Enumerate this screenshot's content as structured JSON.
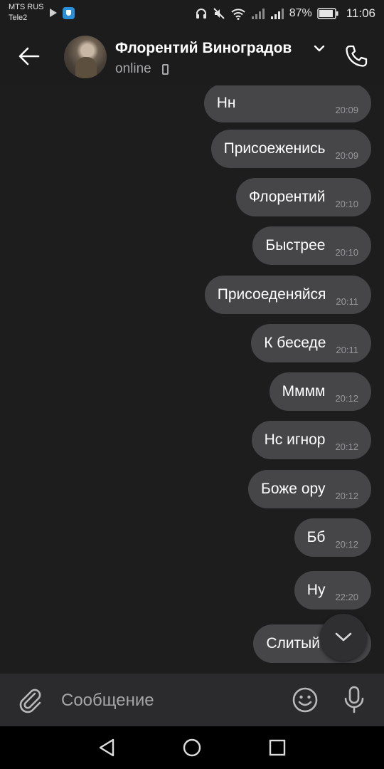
{
  "status_bar": {
    "carrier_1": "MTS RUS",
    "carrier_2": "Tele2",
    "battery": "87%",
    "time": "11:06",
    "icons": [
      "play-icon",
      "app-badge-icon",
      "headphones-icon",
      "mute-icon",
      "wifi-icon",
      "signal-icon",
      "signal-icon",
      "battery-icon"
    ]
  },
  "header": {
    "contact_name": "Флорентий Виноградов",
    "status": "online",
    "icons": [
      "back-arrow-icon",
      "avatar",
      "chevron-down-icon",
      "mobile-device-icon",
      "phone-icon"
    ]
  },
  "messages": [
    {
      "text": "Нн",
      "time": "20:09"
    },
    {
      "text": "Присоеженись",
      "time": "20:09"
    },
    {
      "text": "Флорентий",
      "time": "20:10"
    },
    {
      "text": "Быстрее",
      "time": "20:10"
    },
    {
      "text": "Присоеденяйся",
      "time": "20:11"
    },
    {
      "text": "К беседе",
      "time": "20:11"
    },
    {
      "text": "Мммм",
      "time": "20:12"
    },
    {
      "text": "Нс игнор",
      "time": "20:12"
    },
    {
      "text": "Боже ору",
      "time": "20:12"
    },
    {
      "text": "Бб",
      "time": "20:12"
    },
    {
      "text": "Ну",
      "time": "22:20"
    },
    {
      "text": "Слитый",
      "time": ""
    }
  ],
  "composer": {
    "placeholder": "Сообщение",
    "value": "",
    "icons": [
      "paperclip-icon",
      "emoji-icon",
      "microphone-icon"
    ]
  },
  "navigation": {
    "icons": [
      "back-triangle-icon",
      "home-circle-icon",
      "recents-square-icon"
    ]
  },
  "colors": {
    "background": "#1d1d1e",
    "header": "#1c1c1d",
    "bubble": "#464649",
    "composer": "#2b2b2d",
    "text": "#ffffff",
    "muted_text": "#a8a8aa"
  }
}
